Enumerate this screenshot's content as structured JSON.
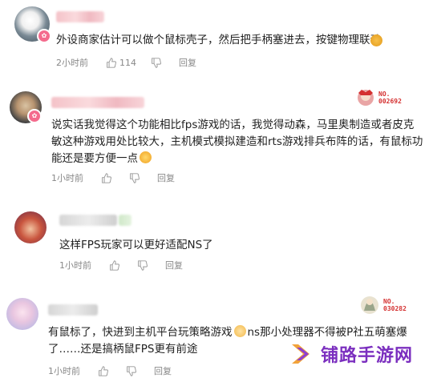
{
  "comments": [
    {
      "text": "外设商家估计可以做个鼠标壳子，然后把手柄塞进去，按键物理联动",
      "time": "2小时前",
      "likes": "114",
      "reply": "回复"
    },
    {
      "text_lines": [
        "说实话我觉得这个功能相比fps游戏的话，我觉得动森，马里奥制造或者皮克",
        "敏这种游戏用处比较大，主机模式模拟建造和rts游戏排兵布阵的话，有鼠标功",
        "能还是要方便一点"
      ],
      "level": "NO.\n002692",
      "time": "1小时前",
      "reply": "回复"
    },
    {
      "text": "这样FPS玩家可以更好适配NS了",
      "time": "1小时前",
      "reply": "回复"
    },
    {
      "text_lines": [
        "有鼠标了，快进到主机平台玩策略游戏",
        "ns那小处理器不得被P社五萌塞爆",
        "了……还是搞柄鼠FPS更有前途"
      ],
      "level": "NO.\n030282",
      "time": "1小时前",
      "reply": "回复"
    }
  ],
  "watermark": "铺路手游网",
  "colors": {
    "meta": "#888888",
    "badge": "#f46b8d",
    "watermark": "#7b2fbf"
  }
}
